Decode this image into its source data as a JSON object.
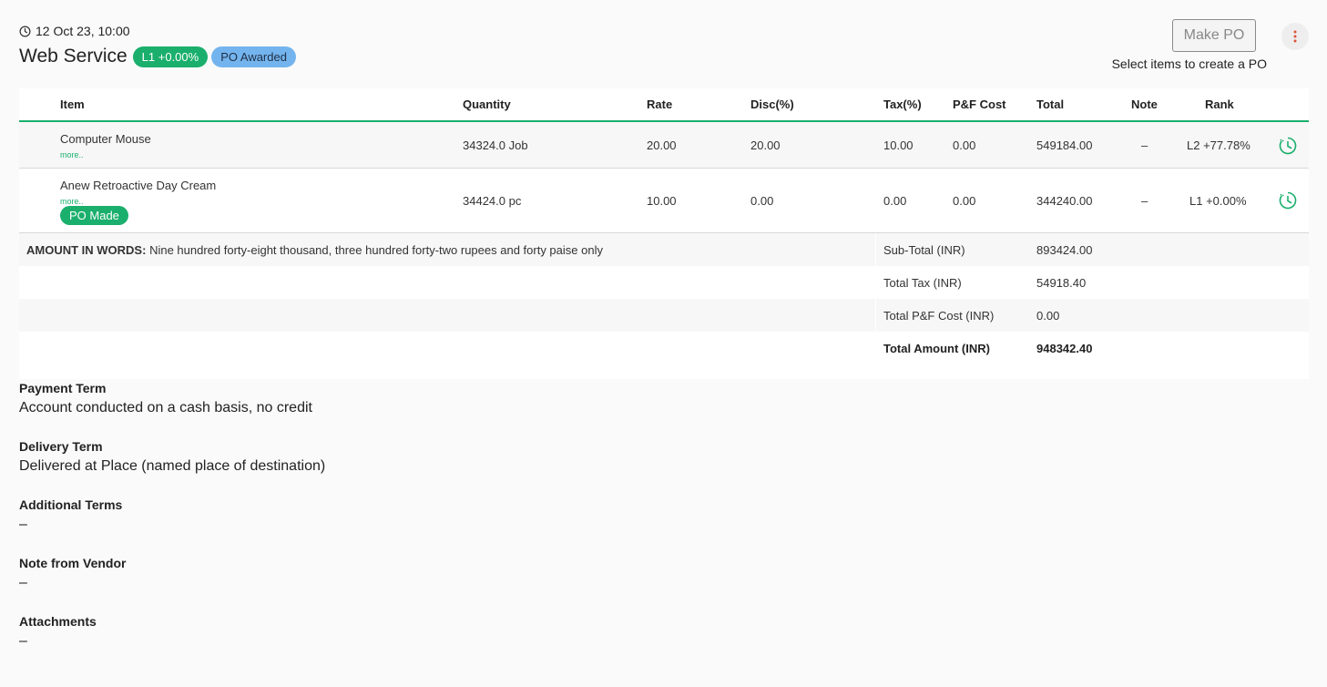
{
  "header": {
    "datetime": "12 Oct 23, 10:00",
    "title": "Web Service",
    "rank_badge": "L1 +0.00%",
    "status_badge": "PO Awarded",
    "make_po_label": "Make PO",
    "select_hint": "Select items to create a PO"
  },
  "table": {
    "columns": {
      "item": "Item",
      "quantity": "Quantity",
      "rate": "Rate",
      "disc": "Disc(%)",
      "tax": "Tax(%)",
      "pf": "P&F Cost",
      "total": "Total",
      "note": "Note",
      "rank": "Rank"
    },
    "rows": [
      {
        "item": "Computer Mouse",
        "more": "more..",
        "quantity": "34324.0 Job",
        "rate": "20.00",
        "disc": "20.00",
        "tax": "10.00",
        "pf": "0.00",
        "total": "549184.00",
        "note": "–",
        "rank": "L2 +77.78%"
      },
      {
        "item": "Anew Retroactive Day Cream",
        "more": "more..",
        "badge": "PO Made",
        "quantity": "34424.0 pc",
        "rate": "10.00",
        "disc": "0.00",
        "tax": "0.00",
        "pf": "0.00",
        "total": "344240.00",
        "note": "–",
        "rank": "L1 +0.00%"
      }
    ]
  },
  "summary": {
    "amount_words_label": "AMOUNT IN WORDS:",
    "amount_words": "Nine hundred forty-eight thousand, three hundred forty-two rupees and forty paise only",
    "subtotal_label": "Sub-Total (INR)",
    "subtotal": "893424.00",
    "tax_label": "Total Tax (INR)",
    "tax": "54918.40",
    "pf_label": "Total P&F Cost (INR)",
    "pf": "0.00",
    "total_label": "Total Amount (INR)",
    "total": "948342.40"
  },
  "terms": {
    "payment_label": "Payment Term",
    "payment": "Account conducted on a cash basis, no credit",
    "delivery_label": "Delivery Term",
    "delivery": "Delivered at Place (named place of destination)",
    "additional_label": "Additional Terms",
    "additional": "–",
    "vendor_note_label": "Note from Vendor",
    "vendor_note": "–",
    "attachments_label": "Attachments",
    "attachments": "–"
  },
  "colors": {
    "accent_green": "#1aaf6c",
    "badge_blue": "#74b4ee",
    "menu_dots": "#e0533a"
  },
  "icons": {
    "datetime": "clock-icon",
    "menu": "more-vertical-icon",
    "rank_history": "history-clock-icon"
  }
}
